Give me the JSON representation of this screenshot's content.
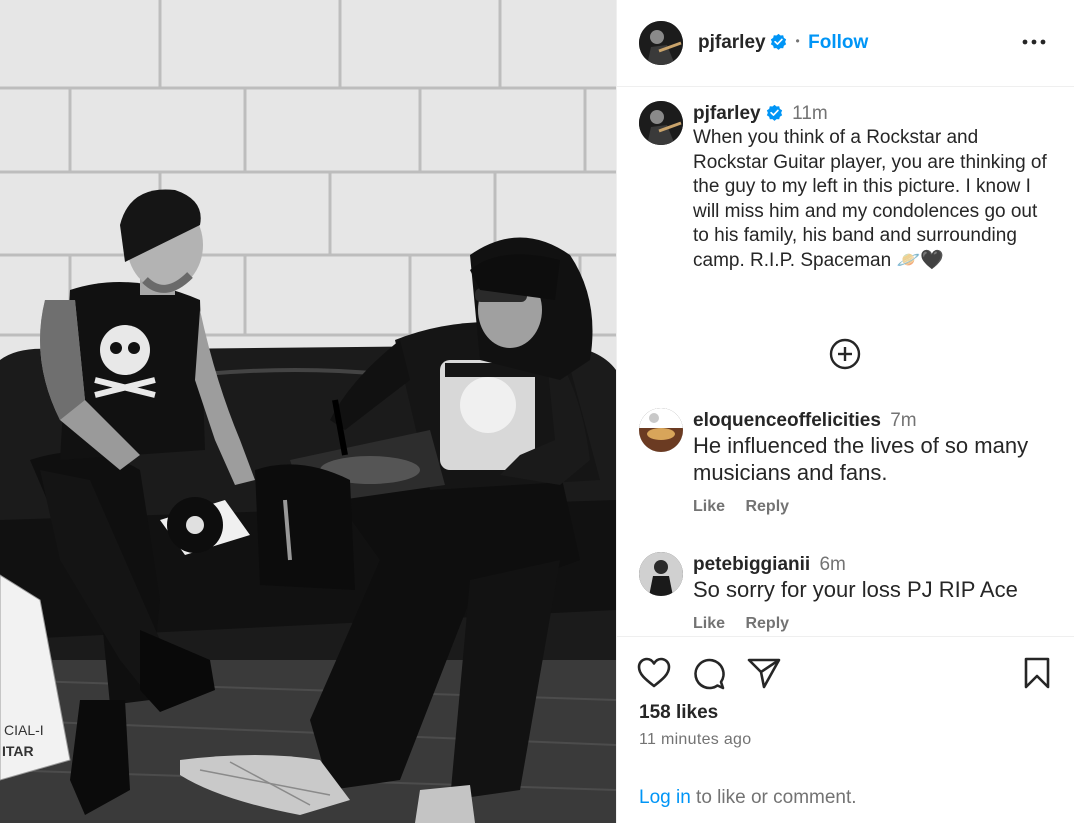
{
  "post": {
    "username": "pjfarley",
    "dot": "•",
    "follow_label": "Follow",
    "more_icon": "more-options-icon",
    "caption_username": "pjfarley",
    "caption_time": "11m",
    "caption_text": "When you think of a Rockstar and Rockstar Guitar player, you are thinking of the guy to my left in this picture. I know I will miss him and my condolences go out to his family, his band and surrounding camp. R.I.P. Spaceman 🪐🖤",
    "add_icon": "add-circle-icon"
  },
  "comments": [
    {
      "username": "eloquenceoffelicities",
      "time": "7m",
      "text": "He influenced the lives of so many musicians and fans.",
      "like_label": "Like",
      "reply_label": "Reply"
    },
    {
      "username": "petebiggianii",
      "time": "6m",
      "text": "So sorry for your loss PJ RIP Ace",
      "like_label": "Like",
      "reply_label": "Reply"
    }
  ],
  "actions": {
    "likes": "158 likes",
    "time_ago": "11 minutes ago",
    "login_link": "Log in",
    "login_rest": " to like or comment."
  },
  "photo": {
    "box_text_1": "CIAL-I",
    "box_text_2": "ITAR"
  },
  "colors": {
    "accent": "#0095f6",
    "text": "#262626",
    "muted": "#737373",
    "verified": "#0095f6"
  }
}
